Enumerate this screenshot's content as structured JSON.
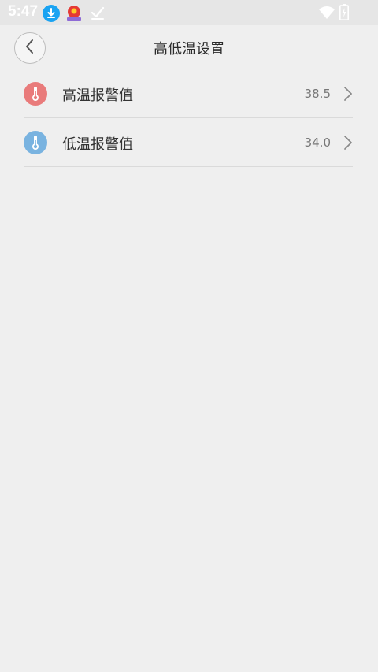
{
  "status_bar": {
    "time": "5:47",
    "icons": [
      "download-icon",
      "app-notification-icon",
      "check-icon",
      "wifi-icon",
      "battery-icon"
    ]
  },
  "header": {
    "title": "高低温设置",
    "back_icon": "chevron-left-icon"
  },
  "items": [
    {
      "label": "高温报警值",
      "value": "38.5",
      "icon": "thermometer-icon",
      "color": "#e97b7b"
    },
    {
      "label": "低温报警值",
      "value": "34.0",
      "icon": "thermometer-icon",
      "color": "#79b3e0"
    }
  ],
  "colors": {
    "background": "#efefef",
    "high_temp": "#e97b7b",
    "low_temp": "#79b3e0"
  }
}
